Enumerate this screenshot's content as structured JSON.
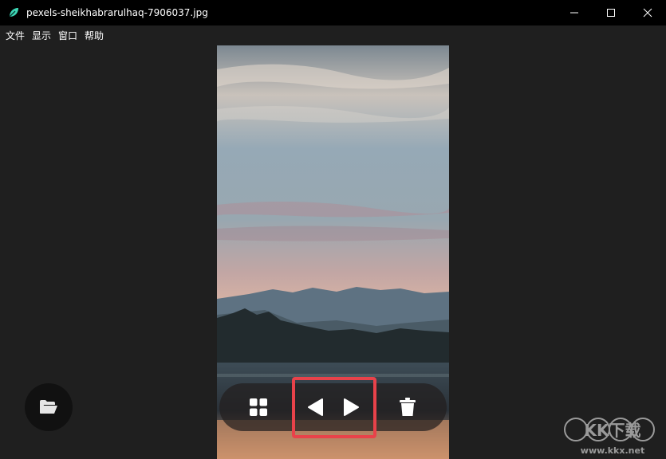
{
  "window": {
    "title": "pexels-sheikhabrarulhaq-7906037.jpg",
    "app_icon": "leaf-icon",
    "controls": [
      "minimize-icon",
      "maximize-icon",
      "close-icon"
    ]
  },
  "menu": {
    "items": [
      {
        "label": "文件"
      },
      {
        "label": "显示"
      },
      {
        "label": "窗口"
      },
      {
        "label": "帮助"
      }
    ]
  },
  "toolbar": {
    "buttons": [
      {
        "icon": "grid-icon"
      },
      {
        "icon": "previous-icon"
      },
      {
        "icon": "next-icon"
      },
      {
        "icon": "trash-icon"
      }
    ],
    "highlight_color": "#e8424a"
  },
  "floating": {
    "open_icon": "folder-open-icon"
  },
  "watermark": {
    "text": "KK下载",
    "url": "www.kkx.net"
  },
  "colors": {
    "background": "#1f1f1f",
    "titlebar": "#000000",
    "accent_leaf": "#3dd6b5"
  }
}
